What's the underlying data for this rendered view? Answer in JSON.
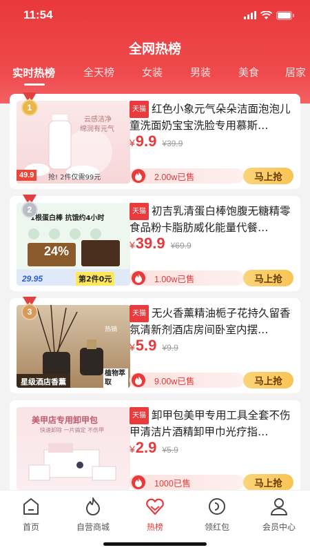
{
  "status": {
    "time": "11:54"
  },
  "page": {
    "title": "全网热榜"
  },
  "tabs": [
    {
      "label": "实时热榜",
      "active": true
    },
    {
      "label": "全天榜"
    },
    {
      "label": "女装"
    },
    {
      "label": "男装"
    },
    {
      "label": "美食"
    },
    {
      "label": "居家"
    }
  ],
  "badge_label": "天猫",
  "buy_label": "马上抢",
  "currency": "¥",
  "products": [
    {
      "rank": "1",
      "title": "红色小象元气朵朵洁面泡泡儿童洗面奶宝宝洗脸专用慕斯…",
      "price": "9.9",
      "original_price": "¥39.9",
      "sold": "2.00w已售",
      "image": {
        "text_a": "云感洁净",
        "text_b": "绵润有元气",
        "tag": "49.9",
        "caption": "抢! 2件仅需99元"
      }
    },
    {
      "rank": "2",
      "title": "初吉乳清蛋白棒饱腹无糖精零食品粉卡脂肪威化能量代餐…",
      "price": "39.9",
      "original_price": "¥69.9",
      "sold": "1.00w已售",
      "image": {
        "text_a": "1根蛋白棒 抗饿约4小时",
        "text_b": "24%",
        "tag": "29.95",
        "caption": "第2件0元"
      }
    },
    {
      "rank": "3",
      "title": "无火香薰精油栀子花持久留香氛清新剂酒店房间卧室内摆…",
      "price": "5.9",
      "original_price": "¥9.9",
      "sold": "9.00w已售",
      "image": {
        "text_a": "热销",
        "text_b": "植物萃取",
        "caption": "星级酒店香薰"
      }
    },
    {
      "rank": "",
      "title": "卸甲包美甲专用工具全套不伤甲清洁片酒精卸甲巾光疗指…",
      "price": "2.9",
      "original_price": "¥5.9",
      "sold": "1000已售",
      "image": {
        "text_a": "美甲店专用卸甲包",
        "text_b": "快速卸除 一片搞定 不伤甲"
      }
    }
  ],
  "tabbar": [
    {
      "label": "首页",
      "icon": "home-icon"
    },
    {
      "label": "自营商城",
      "icon": "flame-icon"
    },
    {
      "label": "热榜",
      "icon": "heart-icon",
      "active": true
    },
    {
      "label": "领红包",
      "icon": "coupon-icon"
    },
    {
      "label": "会员中心",
      "icon": "person-icon"
    }
  ],
  "colors": {
    "accent": "#e93b3d",
    "buy_button": "#f7c455",
    "gold_medal": "#e8b64a",
    "silver_medal": "#b9bec6",
    "bronze_medal": "#d89a5a"
  }
}
